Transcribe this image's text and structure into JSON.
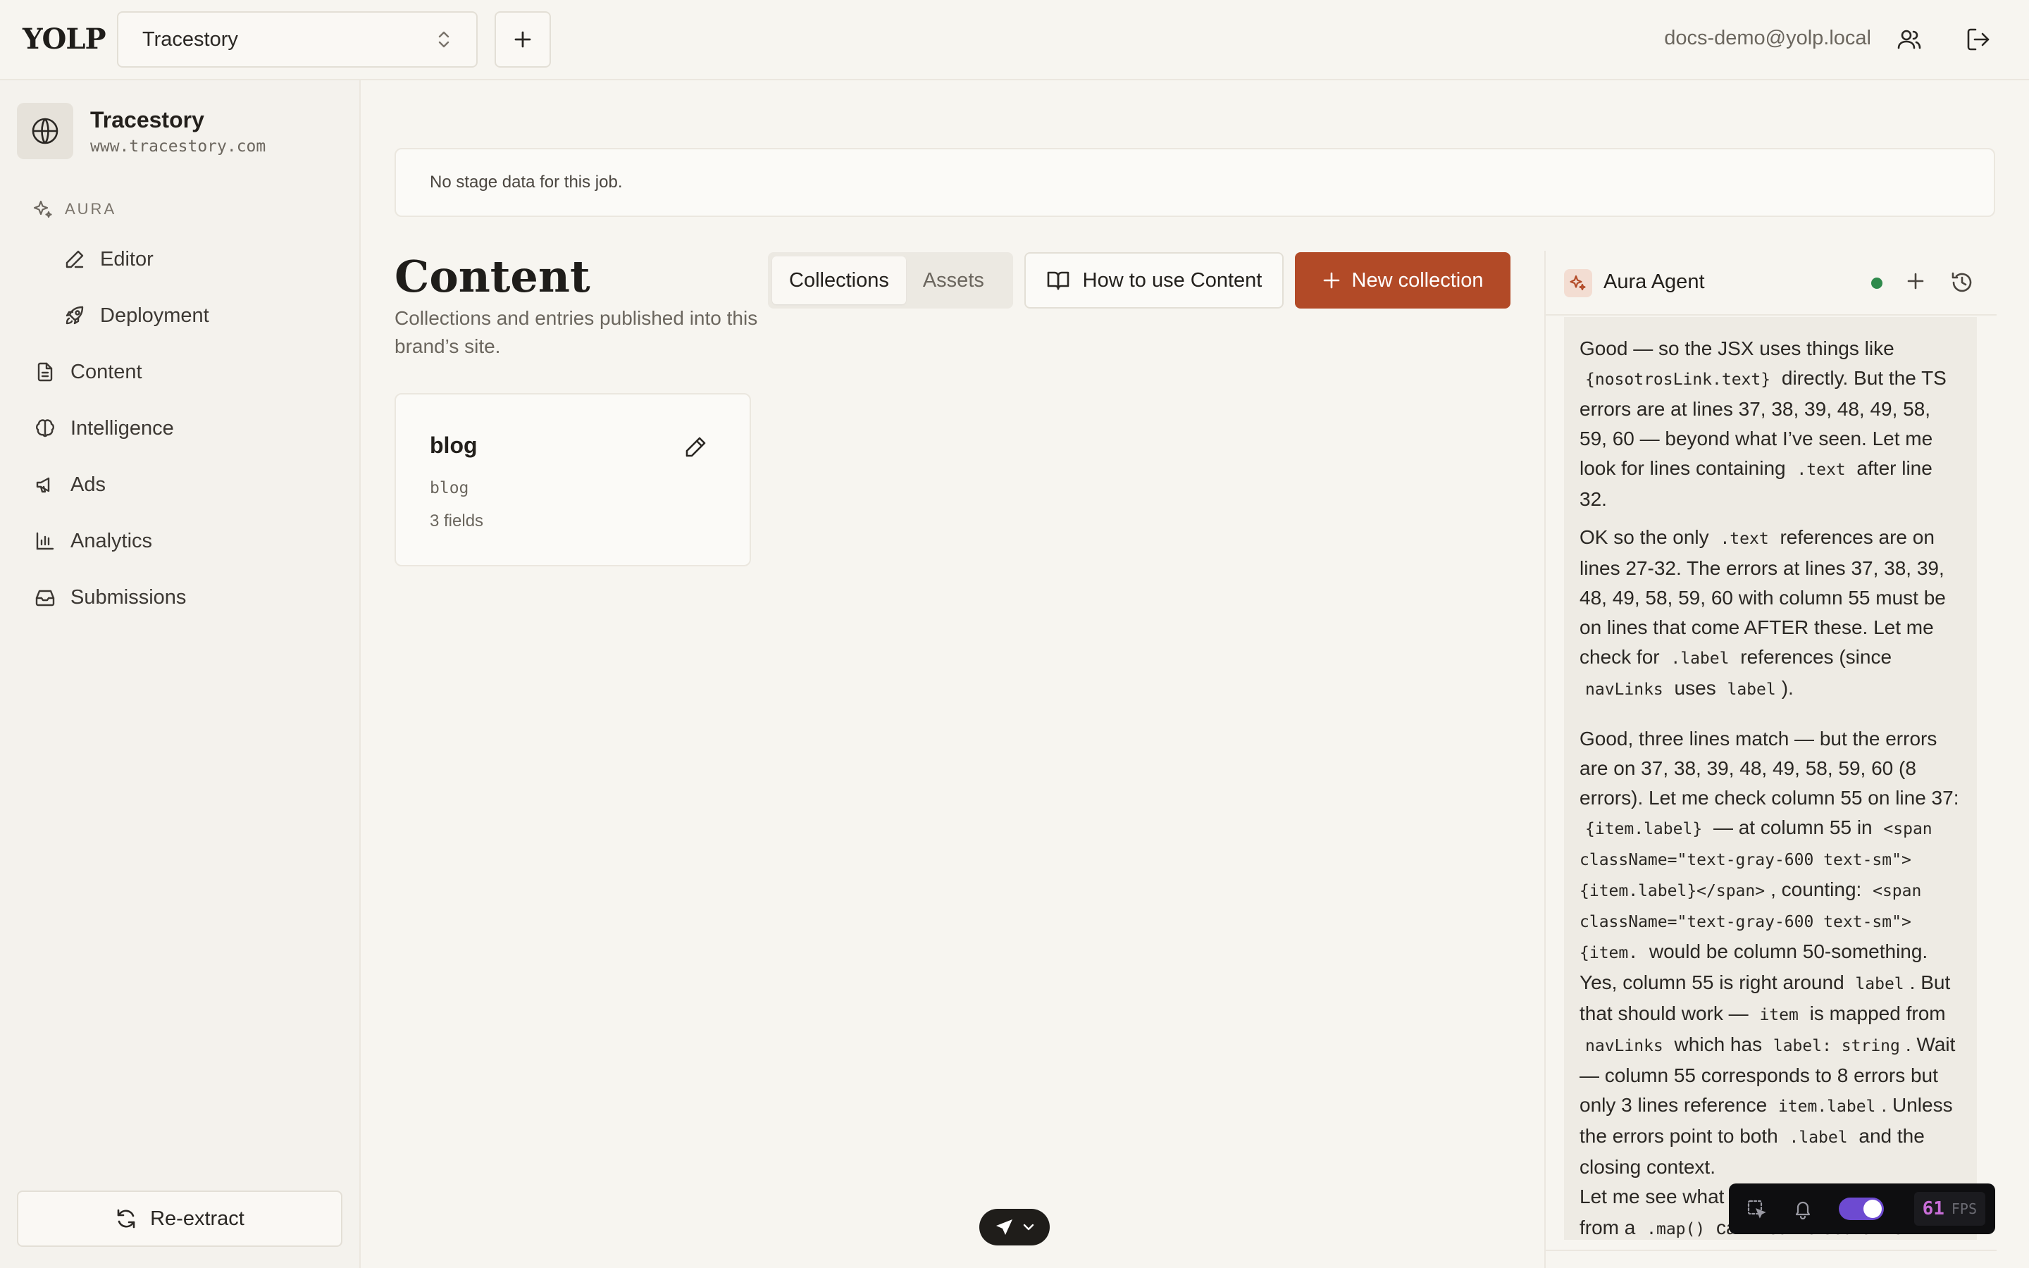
{
  "topbar": {
    "logo": "YOLP",
    "site_selector_value": "Tracestory",
    "user_email": "docs-demo@yolp.local"
  },
  "sidebar": {
    "brand_name": "Tracestory",
    "brand_url": "www.tracestory.com",
    "section_label": "AURA",
    "items": [
      {
        "label": "Editor",
        "icon": "pen-icon"
      },
      {
        "label": "Deployment",
        "icon": "rocket-icon"
      },
      {
        "label": "Content",
        "icon": "document-icon"
      },
      {
        "label": "Intelligence",
        "icon": "brain-icon"
      },
      {
        "label": "Ads",
        "icon": "megaphone-icon"
      },
      {
        "label": "Analytics",
        "icon": "bar-chart-icon"
      },
      {
        "label": "Submissions",
        "icon": "inbox-icon"
      }
    ],
    "reextract_label": "Re-extract"
  },
  "main": {
    "stage_banner": "No stage data for this job.",
    "title": "Content",
    "subtitle": "Collections and entries published into this brand’s site.",
    "tabs": [
      {
        "label": "Collections",
        "active": true
      },
      {
        "label": "Assets",
        "active": false
      }
    ],
    "howto_label": "How to use Content",
    "new_collection_label": "New collection",
    "collections": [
      {
        "name": "blog",
        "slug": "blog",
        "fields": "3 fields"
      }
    ]
  },
  "agent": {
    "title": "Aura Agent",
    "status_color": "#2f8a4c"
  },
  "devbar": {
    "fps_value": "61",
    "fps_label": "FPS"
  },
  "colors": {
    "accent": "#b24a27",
    "background": "#f7f5f0"
  }
}
